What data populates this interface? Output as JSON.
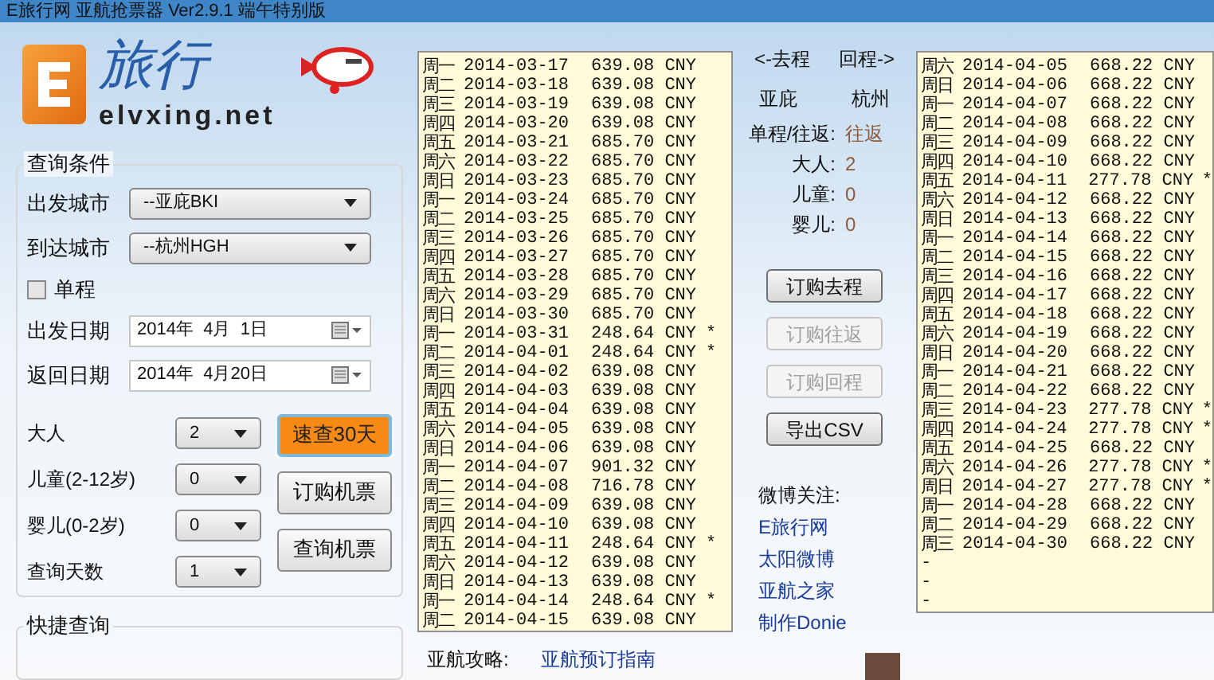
{
  "window": {
    "title": "E旅行网 亚航抢票器 Ver2.9.1 端午特别版"
  },
  "logo": {
    "text": "elvxing.net",
    "mark": "旅行"
  },
  "query": {
    "title": "查询条件",
    "departure_city": {
      "label": "出发城市",
      "value": "--亚庇BKI"
    },
    "arrival_city": {
      "label": "到达城市",
      "value": "--杭州HGH"
    },
    "one_way": {
      "label": "单程",
      "checked": false
    },
    "departure_date": {
      "label": "出发日期",
      "value": "2014年  4月  1日"
    },
    "return_date": {
      "label": "返回日期",
      "value": "2014年  4月20日"
    },
    "counts": [
      {
        "label": "大人",
        "value": "2"
      },
      {
        "label": "儿童(2-12岁)",
        "value": "0"
      },
      {
        "label": "婴儿(0-2岁)",
        "value": "0"
      },
      {
        "label": "查询天数",
        "value": "1"
      }
    ],
    "buttons": [
      {
        "label": "速查30天",
        "highlighted": true
      },
      {
        "label": "订购机票",
        "highlighted": false
      },
      {
        "label": "查询机票",
        "highlighted": false
      }
    ]
  },
  "quick_query": {
    "title": "快捷查询"
  },
  "outbound_list": [
    {
      "weekday": "周一",
      "date": "2014-03-17",
      "price": "639.08 CNY"
    },
    {
      "weekday": "周二",
      "date": "2014-03-18",
      "price": "639.08 CNY"
    },
    {
      "weekday": "周三",
      "date": "2014-03-19",
      "price": "639.08 CNY"
    },
    {
      "weekday": "周四",
      "date": "2014-03-20",
      "price": "639.08 CNY"
    },
    {
      "weekday": "周五",
      "date": "2014-03-21",
      "price": "685.70 CNY"
    },
    {
      "weekday": "周六",
      "date": "2014-03-22",
      "price": "685.70 CNY"
    },
    {
      "weekday": "周日",
      "date": "2014-03-23",
      "price": "685.70 CNY"
    },
    {
      "weekday": "周一",
      "date": "2014-03-24",
      "price": "685.70 CNY"
    },
    {
      "weekday": "周二",
      "date": "2014-03-25",
      "price": "685.70 CNY"
    },
    {
      "weekday": "周三",
      "date": "2014-03-26",
      "price": "685.70 CNY"
    },
    {
      "weekday": "周四",
      "date": "2014-03-27",
      "price": "685.70 CNY"
    },
    {
      "weekday": "周五",
      "date": "2014-03-28",
      "price": "685.70 CNY"
    },
    {
      "weekday": "周六",
      "date": "2014-03-29",
      "price": "685.70 CNY"
    },
    {
      "weekday": "周日",
      "date": "2014-03-30",
      "price": "685.70 CNY"
    },
    {
      "weekday": "周一",
      "date": "2014-03-31",
      "price": "248.64 CNY",
      "mark": "*"
    },
    {
      "weekday": "周二",
      "date": "2014-04-01",
      "price": "248.64 CNY",
      "mark": "*"
    },
    {
      "weekday": "周三",
      "date": "2014-04-02",
      "price": "639.08 CNY"
    },
    {
      "weekday": "周四",
      "date": "2014-04-03",
      "price": "639.08 CNY"
    },
    {
      "weekday": "周五",
      "date": "2014-04-04",
      "price": "639.08 CNY"
    },
    {
      "weekday": "周六",
      "date": "2014-04-05",
      "price": "639.08 CNY"
    },
    {
      "weekday": "周日",
      "date": "2014-04-06",
      "price": "639.08 CNY"
    },
    {
      "weekday": "周一",
      "date": "2014-04-07",
      "price": "901.32 CNY"
    },
    {
      "weekday": "周二",
      "date": "2014-04-08",
      "price": "716.78 CNY"
    },
    {
      "weekday": "周三",
      "date": "2014-04-09",
      "price": "639.08 CNY"
    },
    {
      "weekday": "周四",
      "date": "2014-04-10",
      "price": "639.08 CNY"
    },
    {
      "weekday": "周五",
      "date": "2014-04-11",
      "price": "248.64 CNY",
      "mark": "*"
    },
    {
      "weekday": "周六",
      "date": "2014-04-12",
      "price": "639.08 CNY"
    },
    {
      "weekday": "周日",
      "date": "2014-04-13",
      "price": "639.08 CNY"
    },
    {
      "weekday": "周一",
      "date": "2014-04-14",
      "price": "248.64 CNY",
      "mark": "*"
    },
    {
      "weekday": "周二",
      "date": "2014-04-15",
      "price": "639.08 CNY"
    }
  ],
  "guide": {
    "label": "亚航攻略:",
    "link": "亚航预订指南"
  },
  "summary": {
    "outbound_heading": "<-去程",
    "return_heading": "回程->",
    "origin": "亚庇",
    "destination": "杭州",
    "fields": [
      {
        "label": "单程/往返:",
        "value": "往返"
      },
      {
        "label": "大人:",
        "value": "2"
      },
      {
        "label": "儿童:",
        "value": "0"
      },
      {
        "label": "婴儿:",
        "value": "0"
      }
    ]
  },
  "actions": [
    {
      "label": "订购去程",
      "disabled": false
    },
    {
      "label": "订购往返",
      "disabled": true
    },
    {
      "label": "订购回程",
      "disabled": true
    },
    {
      "label": "导出CSV",
      "disabled": false
    }
  ],
  "weibo": {
    "label": "微博关注:",
    "links": [
      "E旅行网",
      "太阳微博",
      "亚航之家",
      "制作Donie"
    ]
  },
  "return_list": [
    {
      "weekday": "周六",
      "date": "2014-04-05",
      "price": "668.22 CNY"
    },
    {
      "weekday": "周日",
      "date": "2014-04-06",
      "price": "668.22 CNY"
    },
    {
      "weekday": "周一",
      "date": "2014-04-07",
      "price": "668.22 CNY"
    },
    {
      "weekday": "周二",
      "date": "2014-04-08",
      "price": "668.22 CNY"
    },
    {
      "weekday": "周三",
      "date": "2014-04-09",
      "price": "668.22 CNY"
    },
    {
      "weekday": "周四",
      "date": "2014-04-10",
      "price": "668.22 CNY"
    },
    {
      "weekday": "周五",
      "date": "2014-04-11",
      "price": "277.78 CNY",
      "mark": "*"
    },
    {
      "weekday": "周六",
      "date": "2014-04-12",
      "price": "668.22 CNY"
    },
    {
      "weekday": "周日",
      "date": "2014-04-13",
      "price": "668.22 CNY"
    },
    {
      "weekday": "周一",
      "date": "2014-04-14",
      "price": "668.22 CNY"
    },
    {
      "weekday": "周二",
      "date": "2014-04-15",
      "price": "668.22 CNY"
    },
    {
      "weekday": "周三",
      "date": "2014-04-16",
      "price": "668.22 CNY"
    },
    {
      "weekday": "周四",
      "date": "2014-04-17",
      "price": "668.22 CNY"
    },
    {
      "weekday": "周五",
      "date": "2014-04-18",
      "price": "668.22 CNY"
    },
    {
      "weekday": "周六",
      "date": "2014-04-19",
      "price": "668.22 CNY"
    },
    {
      "weekday": "周日",
      "date": "2014-04-20",
      "price": "668.22 CNY"
    },
    {
      "weekday": "周一",
      "date": "2014-04-21",
      "price": "668.22 CNY"
    },
    {
      "weekday": "周二",
      "date": "2014-04-22",
      "price": "668.22 CNY"
    },
    {
      "weekday": "周三",
      "date": "2014-04-23",
      "price": "277.78 CNY",
      "mark": "*"
    },
    {
      "weekday": "周四",
      "date": "2014-04-24",
      "price": "277.78 CNY",
      "mark": "*"
    },
    {
      "weekday": "周五",
      "date": "2014-04-25",
      "price": "668.22 CNY"
    },
    {
      "weekday": "周六",
      "date": "2014-04-26",
      "price": "277.78 CNY",
      "mark": "*"
    },
    {
      "weekday": "周日",
      "date": "2014-04-27",
      "price": "277.78 CNY",
      "mark": "*"
    },
    {
      "weekday": "周一",
      "date": "2014-04-28",
      "price": "668.22 CNY"
    },
    {
      "weekday": "周二",
      "date": "2014-04-29",
      "price": "668.22 CNY"
    },
    {
      "weekday": "周三",
      "date": "2014-04-30",
      "price": "668.22 CNY"
    }
  ],
  "return_list_placeholders": [
    "-",
    "-",
    "-"
  ]
}
